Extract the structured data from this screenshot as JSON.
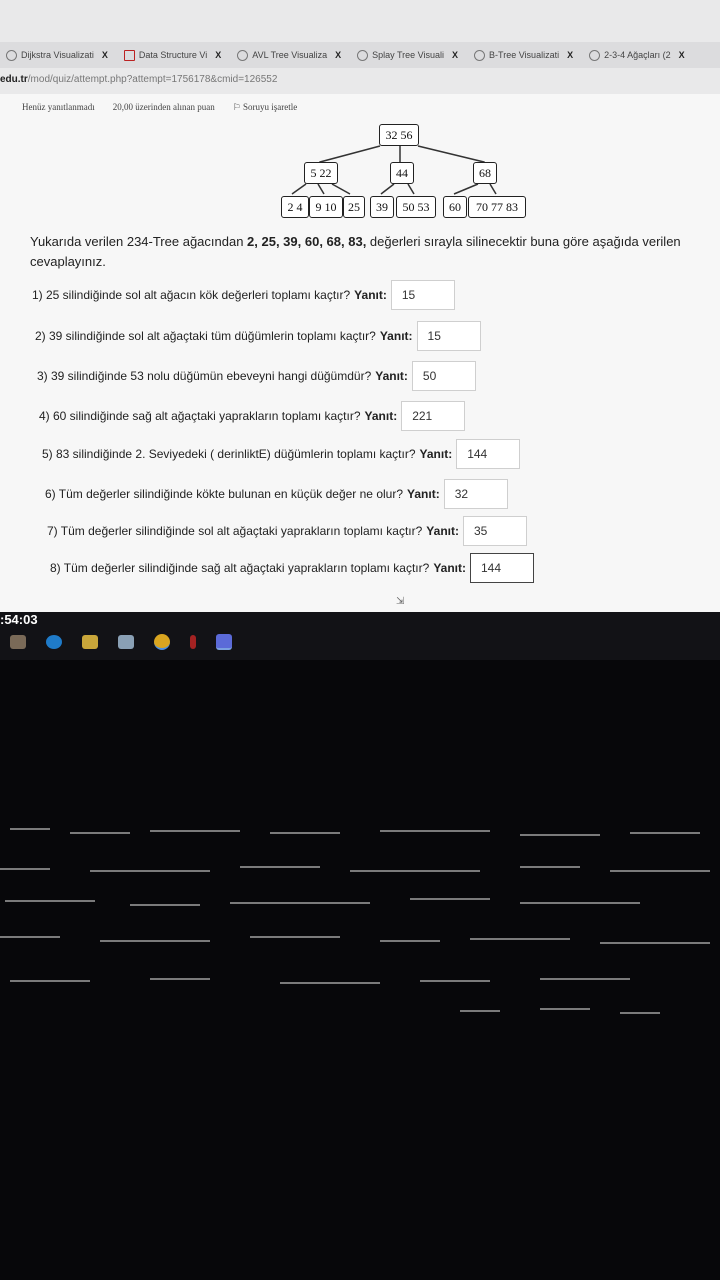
{
  "browser": {
    "tabs": [
      {
        "label": "Dijkstra Visualizati",
        "close": "X"
      },
      {
        "label": "Data Structure Vi",
        "close": "X"
      },
      {
        "label": "AVL Tree Visualiza",
        "close": "X"
      },
      {
        "label": "Splay Tree Visuali",
        "close": "X"
      },
      {
        "label": "B-Tree Visualizati",
        "close": "X"
      },
      {
        "label": "2-3-4 Ağaçları (2",
        "close": "X"
      }
    ],
    "url_host": "edu.tr",
    "url_path": "/mod/quiz/attempt.php?attempt=1756178&cmid=126552"
  },
  "quiz_status": {
    "answered": "Henüz yanıtlanmadı",
    "points": "20,00 üzerinden alınan puan",
    "flag": "Soruyu işaretle"
  },
  "tree": {
    "root": "32 56",
    "level1": [
      "5 22",
      "44",
      "68"
    ],
    "leaves": [
      "2 4",
      "9 10",
      "25",
      "39",
      "50 53",
      "60",
      "70 77 83"
    ]
  },
  "description": {
    "before": "Yukarıda verilen 234-Tree ağacından ",
    "values": "2, 25, 39, 60,  68, 83,",
    "after": " değerleri sırayla silinecektir buna göre aşağıda verilen",
    "line2": "cevaplayınız."
  },
  "answer_keyword": "Yanıt:",
  "questions": [
    {
      "text": "1) 25 silindiğinde sol alt ağacın kök değerleri toplamı kaçtır?",
      "answer": "15"
    },
    {
      "text": "2) 39 silindiğinde sol alt ağaçtaki tüm düğümlerin toplamı kaçtır?",
      "answer": "15"
    },
    {
      "text": "3) 39 silindiğinde 53 nolu düğümün ebeveyni hangi düğümdür?",
      "answer": "50"
    },
    {
      "text": "4) 60 silindiğinde sağ alt ağaçtaki yaprakların toplamı kaçtır?",
      "answer": "221"
    },
    {
      "text": "5) 83 silindiğinde 2. Seviyedeki ( derinliktE) düğümlerin toplamı kaçtır?",
      "answer": "144"
    },
    {
      "text": "6) Tüm değerler silindiğinde kökte bulunan en küçük değer ne olur?",
      "answer": "32"
    },
    {
      "text": "7) Tüm değerler silindiğinde sol alt ağaçtaki yaprakların toplamı kaçtır?",
      "answer": "35"
    },
    {
      "text": "8) Tüm değerler silindiğinde sağ alt ağaçtaki yaprakların toplamı kaçtır?",
      "answer": "144"
    }
  ],
  "timer": ":54:03"
}
